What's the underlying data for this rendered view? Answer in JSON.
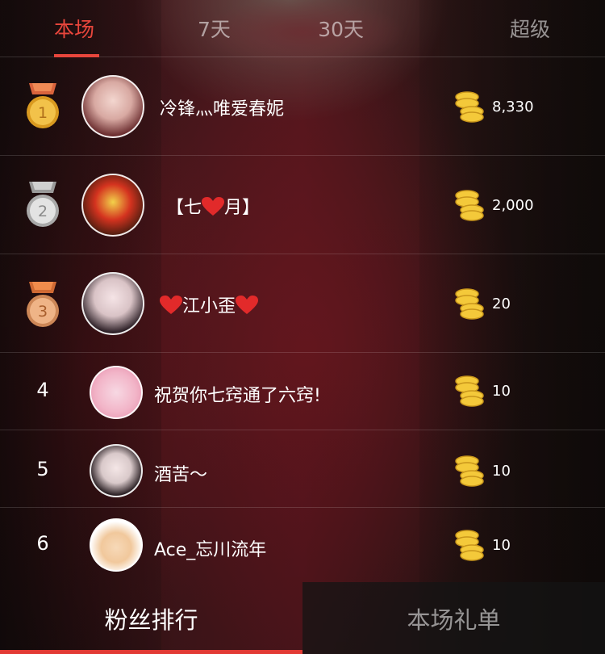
{
  "tabs": [
    {
      "label": "本场",
      "active": true
    },
    {
      "label": "7天",
      "active": false
    },
    {
      "label": "30天",
      "active": false
    },
    {
      "label": "超级",
      "active": false
    }
  ],
  "ranking": [
    {
      "rank": "1",
      "medal": "gold",
      "name": "冷锋灬唯爱春妮",
      "amount": "8,330"
    },
    {
      "rank": "2",
      "medal": "silver",
      "name": "【七",
      "name_suffix": "月】",
      "amount": "2,000"
    },
    {
      "rank": "3",
      "medal": "bronze",
      "name": "江小歪",
      "amount": "20"
    },
    {
      "rank": "4",
      "medal": "",
      "name": "祝贺你七窍通了六窍!",
      "amount": "10"
    },
    {
      "rank": "5",
      "medal": "",
      "name": "酒苦～",
      "amount": "10"
    },
    {
      "rank": "6",
      "medal": "",
      "name": "Ace_忘川流年",
      "amount": "10"
    }
  ],
  "bottom_tabs": [
    {
      "label": "粉丝排行",
      "active": true
    },
    {
      "label": "本场礼单",
      "active": false
    }
  ],
  "colors": {
    "accent": "#e8463c",
    "gold": "#e9b43a",
    "silver": "#c9c9c9",
    "bronze": "#e09a6a",
    "heart": "#e22a2a"
  },
  "icons": {
    "coin": "coin-stack-icon",
    "heart": "heart-icon",
    "medal": "medal-icon"
  }
}
